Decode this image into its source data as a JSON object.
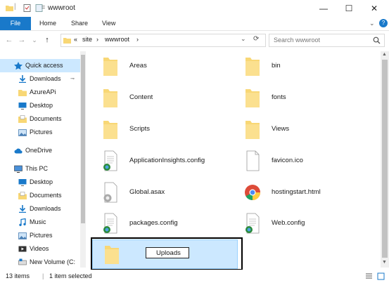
{
  "window": {
    "title": "wwwroot",
    "minimize": "—",
    "maximize": "☐",
    "close": "✕"
  },
  "ribbon": {
    "tabs": [
      "File",
      "Home",
      "Share",
      "View"
    ],
    "expand": "⌄",
    "help": "?"
  },
  "address": {
    "back": "←",
    "forward": "→",
    "recent": "⌄",
    "up": "↑",
    "overflow": "«",
    "crumbs": [
      "site",
      "wwwroot"
    ],
    "separator": "›",
    "dropdown": "⌄",
    "refresh": "⟳"
  },
  "search": {
    "placeholder": "Search wwwroot"
  },
  "nav": {
    "items": [
      {
        "label": "Quick access",
        "icon": "star-icon"
      },
      {
        "label": "Downloads",
        "icon": "download-icon",
        "pin": "📌"
      },
      {
        "label": "AzureAPi",
        "icon": "folder-icon"
      },
      {
        "label": "Desktop",
        "icon": "desktop-icon"
      },
      {
        "label": "Documents",
        "icon": "documents-icon"
      },
      {
        "label": "Pictures",
        "icon": "pictures-icon"
      },
      {
        "label": "OneDrive",
        "icon": "cloud-icon"
      },
      {
        "label": "This PC",
        "icon": "computer-icon"
      },
      {
        "label": "Desktop",
        "icon": "desktop-icon"
      },
      {
        "label": "Documents",
        "icon": "documents-icon"
      },
      {
        "label": "Downloads",
        "icon": "download-icon"
      },
      {
        "label": "Music",
        "icon": "music-icon"
      },
      {
        "label": "Pictures",
        "icon": "pictures-icon"
      },
      {
        "label": "Videos",
        "icon": "videos-icon"
      },
      {
        "label": "New Volume (C:",
        "icon": "drive-icon"
      }
    ]
  },
  "files": [
    {
      "name": "Areas",
      "type": "folder"
    },
    {
      "name": "bin",
      "type": "folder"
    },
    {
      "name": "Content",
      "type": "folder"
    },
    {
      "name": "fonts",
      "type": "folder"
    },
    {
      "name": "Scripts",
      "type": "folder"
    },
    {
      "name": "Views",
      "type": "folder"
    },
    {
      "name": "ApplicationInsights.config",
      "type": "config"
    },
    {
      "name": "favicon.ico",
      "type": "file"
    },
    {
      "name": "Global.asax",
      "type": "asax"
    },
    {
      "name": "hostingstart.html",
      "type": "chrome"
    },
    {
      "name": "packages.config",
      "type": "config"
    },
    {
      "name": "Web.config",
      "type": "config"
    }
  ],
  "rename": {
    "value": "Uploads"
  },
  "status": {
    "items": "13 items",
    "selected": "1 item selected"
  },
  "colors": {
    "accent": "#1979ca",
    "selection": "#cce8ff",
    "folder": "#f8d775"
  }
}
